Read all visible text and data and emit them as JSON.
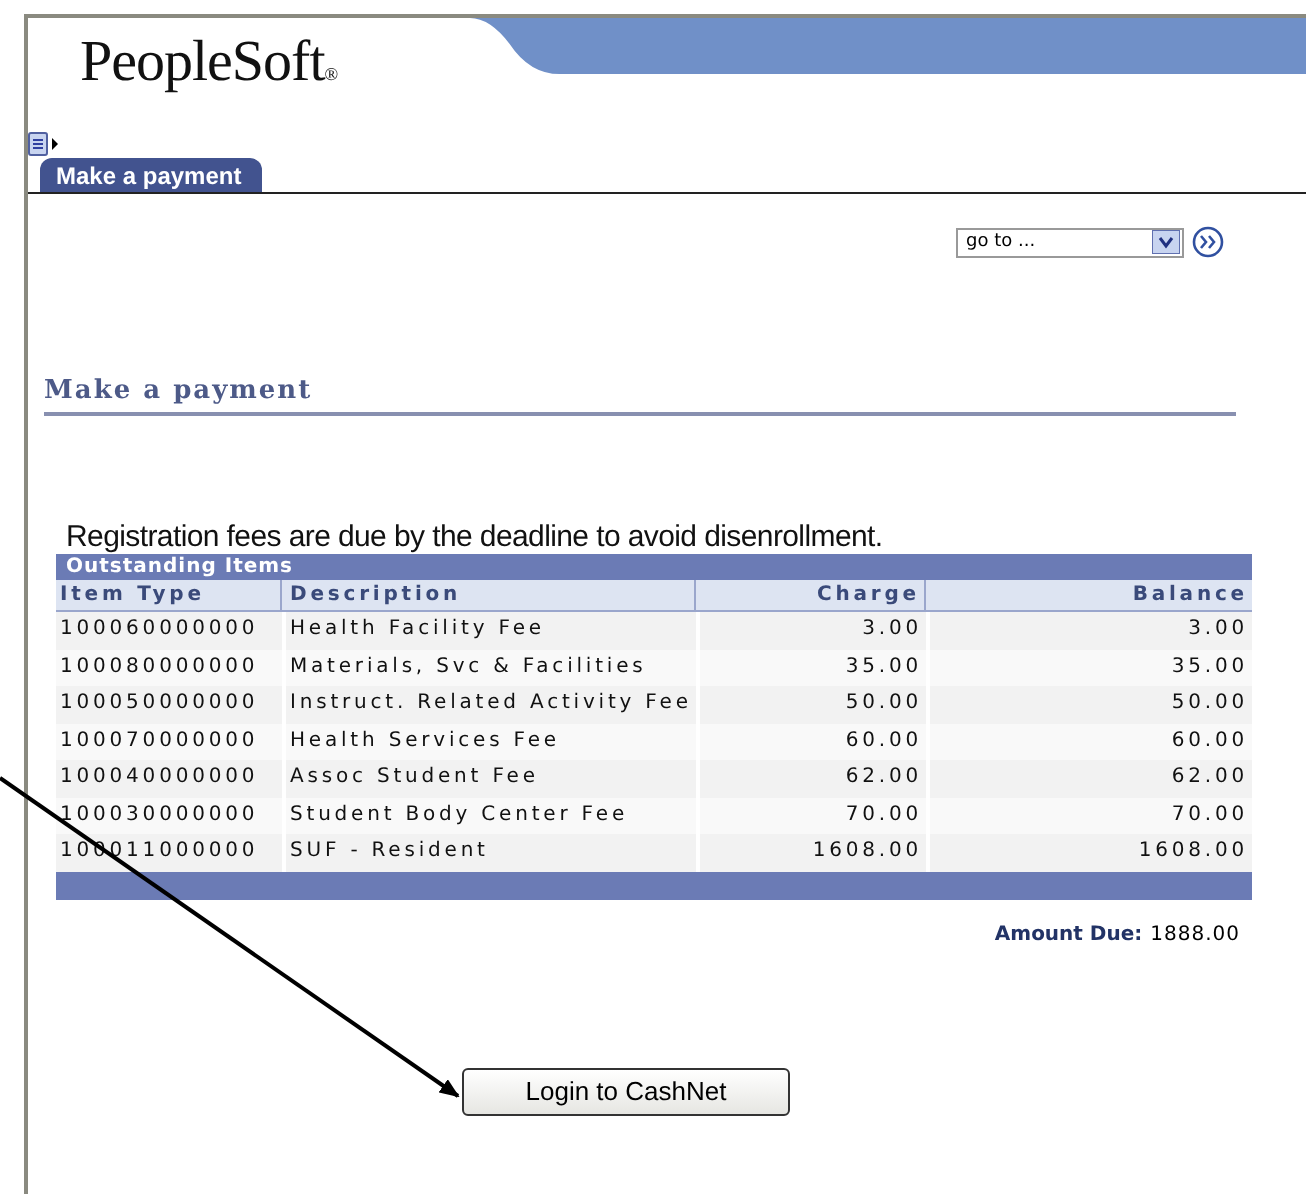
{
  "header": {
    "logo": "PeopleSoft",
    "logo_mark": "®"
  },
  "tabs": [
    {
      "label": "Make a payment",
      "selected": true
    }
  ],
  "goto": {
    "value": "go to ..."
  },
  "page_title": "Make a payment",
  "notice": "Registration fees are due by the deadline to avoid disenrollment.",
  "table": {
    "title": "Outstanding Items",
    "columns": [
      "Item Type",
      "Description",
      "Charge",
      "Balance"
    ],
    "rows": [
      [
        "100060000000",
        "Health Facility Fee",
        "3.00",
        "3.00"
      ],
      [
        "100080000000",
        "Materials, Svc & Facilities",
        "35.00",
        "35.00"
      ],
      [
        "100050000000",
        "Instruct. Related Activity Fee",
        "50.00",
        "50.00"
      ],
      [
        "100070000000",
        "Health Services Fee",
        "60.00",
        "60.00"
      ],
      [
        "100040000000",
        "Assoc Student Fee",
        "62.00",
        "62.00"
      ],
      [
        "100030000000",
        "Student Body Center Fee",
        "70.00",
        "70.00"
      ],
      [
        "100011000000",
        "SUF - Resident",
        "1608.00",
        "1608.00"
      ]
    ]
  },
  "amount_due": {
    "label": "Amount Due:",
    "value": "1888.00"
  },
  "button": "Login to CashNet"
}
